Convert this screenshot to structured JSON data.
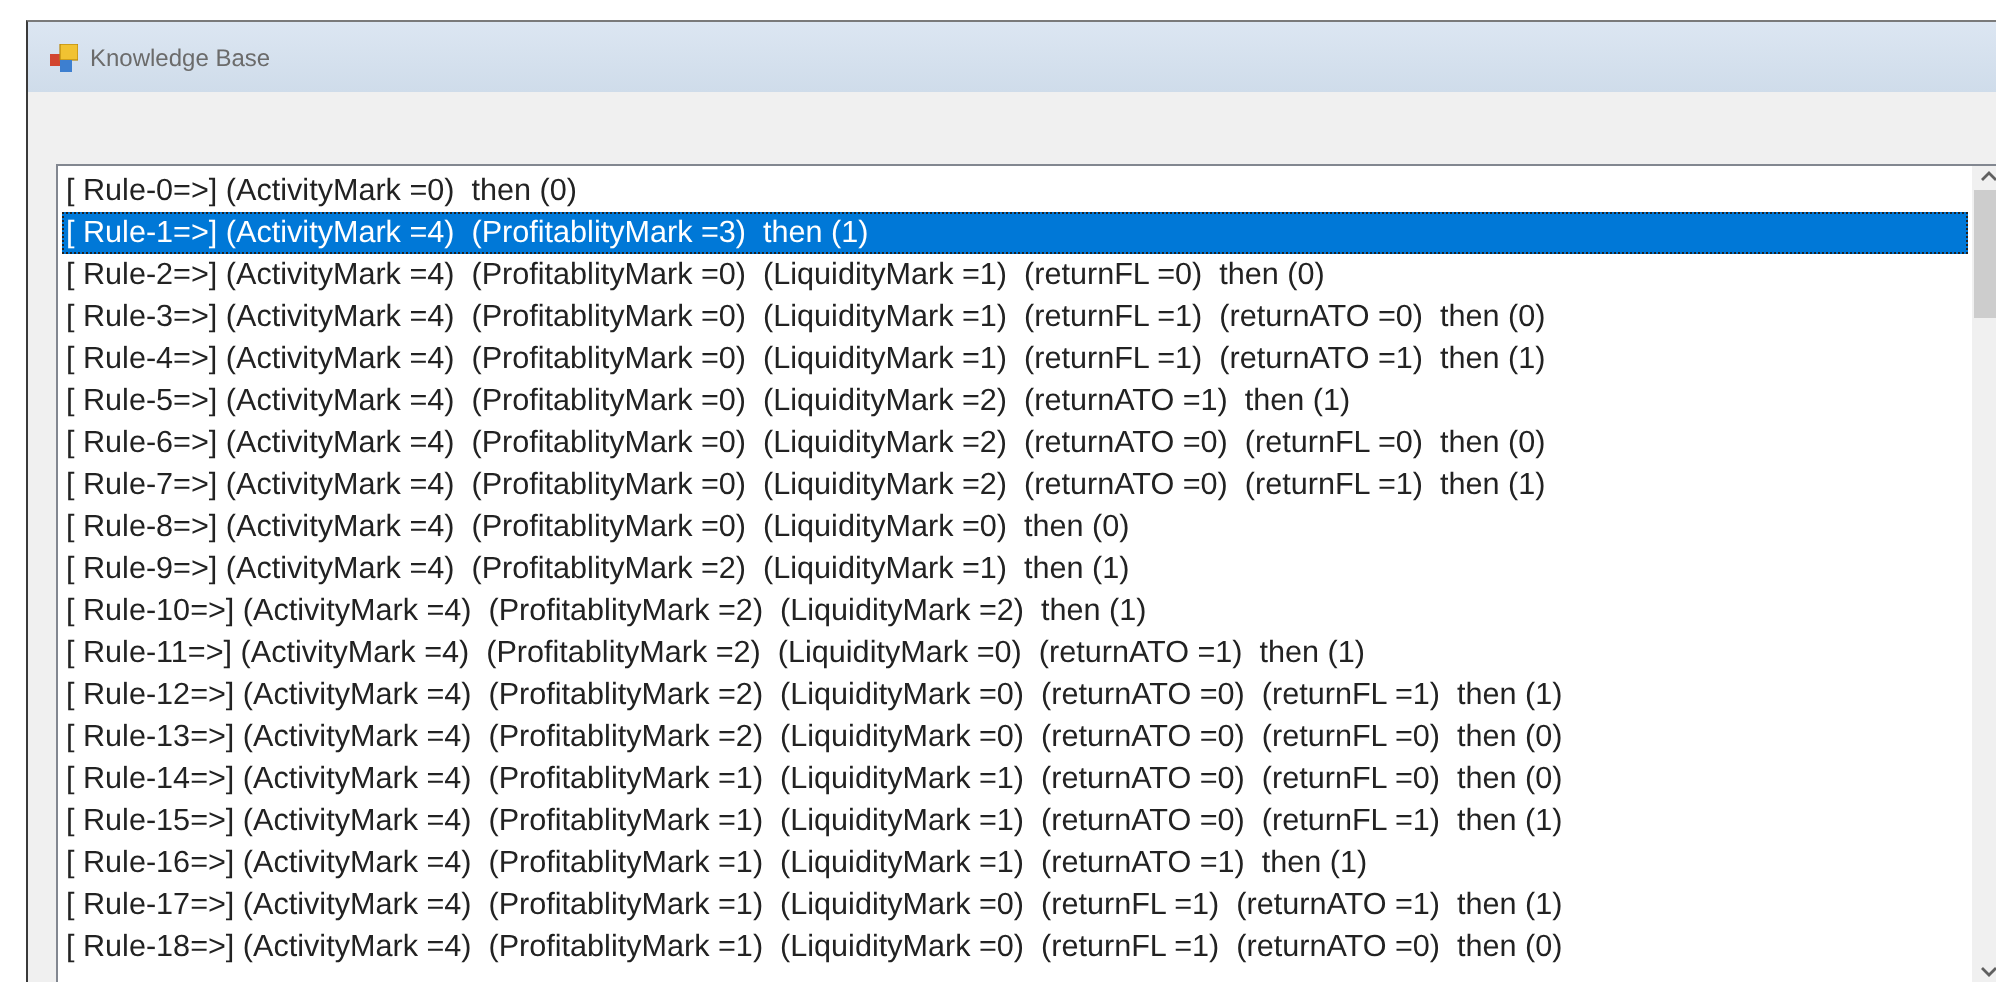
{
  "window": {
    "title": "Knowledge Base"
  },
  "rules": [
    {
      "text": "[ Rule-0=>] (ActivityMark =0)  then (0)",
      "selected": false
    },
    {
      "text": "[ Rule-1=>] (ActivityMark =4)  (ProfitablityMark =3)  then (1)",
      "selected": true
    },
    {
      "text": "[ Rule-2=>] (ActivityMark =4)  (ProfitablityMark =0)  (LiquidityMark =1)  (returnFL =0)  then (0)",
      "selected": false
    },
    {
      "text": "[ Rule-3=>] (ActivityMark =4)  (ProfitablityMark =0)  (LiquidityMark =1)  (returnFL =1)  (returnATO =0)  then (0)",
      "selected": false
    },
    {
      "text": "[ Rule-4=>] (ActivityMark =4)  (ProfitablityMark =0)  (LiquidityMark =1)  (returnFL =1)  (returnATO =1)  then (1)",
      "selected": false
    },
    {
      "text": "[ Rule-5=>] (ActivityMark =4)  (ProfitablityMark =0)  (LiquidityMark =2)  (returnATO =1)  then (1)",
      "selected": false
    },
    {
      "text": "[ Rule-6=>] (ActivityMark =4)  (ProfitablityMark =0)  (LiquidityMark =2)  (returnATO =0)  (returnFL =0)  then (0)",
      "selected": false
    },
    {
      "text": "[ Rule-7=>] (ActivityMark =4)  (ProfitablityMark =0)  (LiquidityMark =2)  (returnATO =0)  (returnFL =1)  then (1)",
      "selected": false
    },
    {
      "text": "[ Rule-8=>] (ActivityMark =4)  (ProfitablityMark =0)  (LiquidityMark =0)  then (0)",
      "selected": false
    },
    {
      "text": "[ Rule-9=>] (ActivityMark =4)  (ProfitablityMark =2)  (LiquidityMark =1)  then (1)",
      "selected": false
    },
    {
      "text": "[ Rule-10=>] (ActivityMark =4)  (ProfitablityMark =2)  (LiquidityMark =2)  then (1)",
      "selected": false
    },
    {
      "text": "[ Rule-11=>] (ActivityMark =4)  (ProfitablityMark =2)  (LiquidityMark =0)  (returnATO =1)  then (1)",
      "selected": false
    },
    {
      "text": "[ Rule-12=>] (ActivityMark =4)  (ProfitablityMark =2)  (LiquidityMark =0)  (returnATO =0)  (returnFL =1)  then (1)",
      "selected": false
    },
    {
      "text": "[ Rule-13=>] (ActivityMark =4)  (ProfitablityMark =2)  (LiquidityMark =0)  (returnATO =0)  (returnFL =0)  then (0)",
      "selected": false
    },
    {
      "text": "[ Rule-14=>] (ActivityMark =4)  (ProfitablityMark =1)  (LiquidityMark =1)  (returnATO =0)  (returnFL =0)  then (0)",
      "selected": false
    },
    {
      "text": "[ Rule-15=>] (ActivityMark =4)  (ProfitablityMark =1)  (LiquidityMark =1)  (returnATO =0)  (returnFL =1)  then (1)",
      "selected": false
    },
    {
      "text": "[ Rule-16=>] (ActivityMark =4)  (ProfitablityMark =1)  (LiquidityMark =1)  (returnATO =1)  then (1)",
      "selected": false
    },
    {
      "text": "[ Rule-17=>] (ActivityMark =4)  (ProfitablityMark =1)  (LiquidityMark =0)  (returnFL =1)  (returnATO =1)  then (1)",
      "selected": false
    },
    {
      "text": "[ Rule-18=>] (ActivityMark =4)  (ProfitablityMark =1)  (LiquidityMark =0)  (returnFL =1)  (returnATO =0)  then (0)",
      "selected": false
    }
  ]
}
